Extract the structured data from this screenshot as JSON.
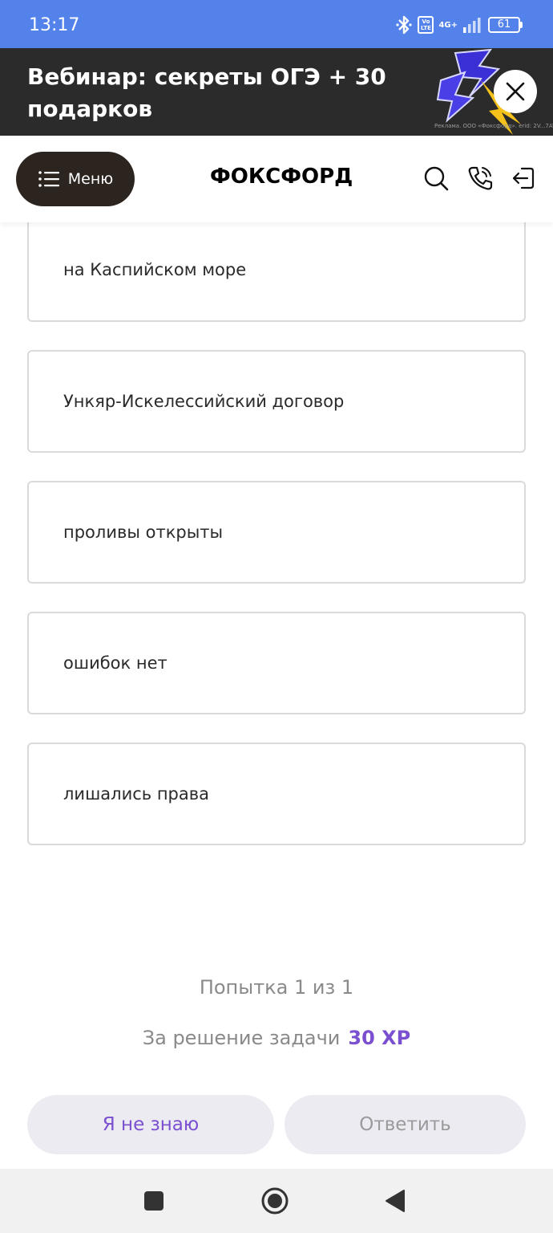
{
  "status_bar": {
    "time": "13:17",
    "volte": "Vo LTE",
    "network": "4G+",
    "battery": "61",
    "icons": [
      "bluetooth-icon",
      "volte-icon",
      "signal-icon",
      "battery-icon"
    ]
  },
  "ad": {
    "title": "Вебинар: секреты ОГЭ + 30 подарков",
    "disclaimer": "Реклама. ООО «Фоксфорд». erid: 2V...7ATGm",
    "close_icon": "close-icon"
  },
  "header": {
    "menu_label": "Меню",
    "logo": "ФОКСФОРД",
    "icons": [
      "search-icon",
      "phone-icon",
      "login-icon"
    ]
  },
  "options": [
    "на Каспийском море",
    "Ункяр-Искелессийский договор",
    "проливы открыты",
    "ошибок нет",
    "лишались права"
  ],
  "attempt_text": "Попытка 1 из 1",
  "reward": {
    "label": "За решение задачи",
    "xp": "30 XP"
  },
  "buttons": {
    "dont_know": "Я не знаю",
    "answer": "Ответить"
  },
  "colors": {
    "status_bar": "#5282ea",
    "ad_background": "#2b2b2b",
    "menu_button": "#2c241f",
    "accent": "#7a4fd0",
    "button_bg": "#ecebf2"
  },
  "nav_bar": {
    "icons": [
      "recent-apps-icon",
      "home-icon",
      "back-icon"
    ]
  }
}
